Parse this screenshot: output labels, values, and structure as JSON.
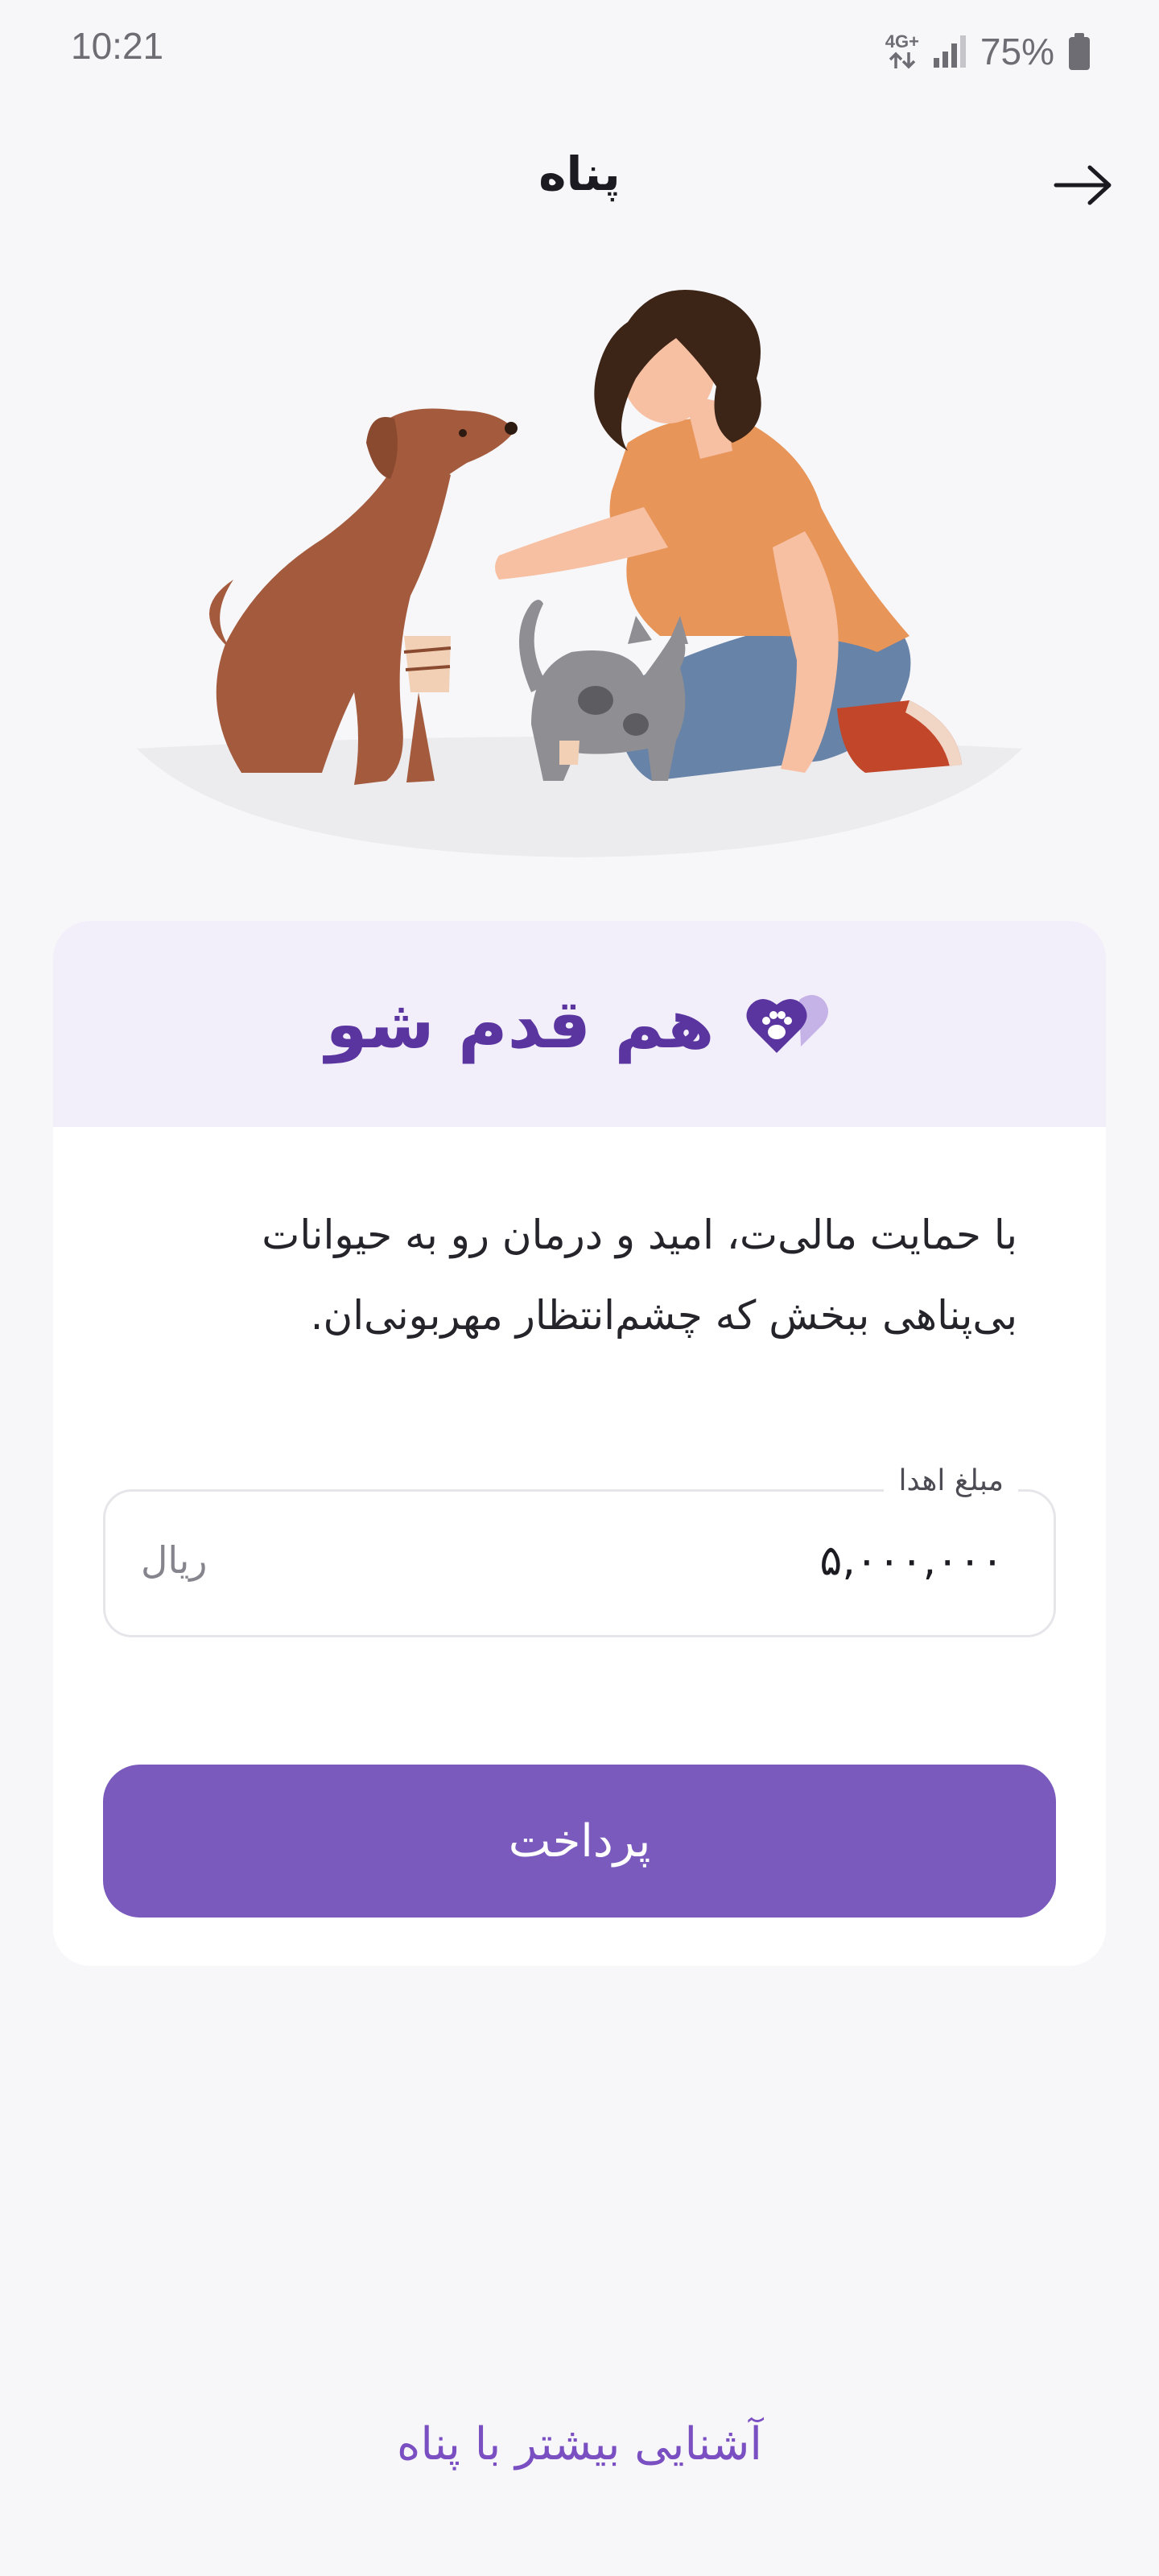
{
  "status_bar": {
    "time": "10:21",
    "network": "4G+",
    "battery_percent": "75%",
    "icons": [
      "data-arrows-icon",
      "signal-icon",
      "battery-icon"
    ]
  },
  "header": {
    "title": "پناه",
    "back_icon": "arrow-right-icon"
  },
  "hero": {
    "illustration": "woman-dog-cat-illustration"
  },
  "card": {
    "title": "هم قدم شو",
    "title_icon": "paw-heart-icon",
    "description": "با حمایت مالی‌ت، امید و درمان رو به حیوانات بی‌پناهی ببخش که چشم‌انتظار مهربونی‌ان.",
    "amount_field": {
      "label": "مبلغ اهدا",
      "value": "۵,۰۰۰,۰۰۰",
      "unit": "ریال"
    },
    "pay_button": "پرداخت"
  },
  "footer": {
    "link": "آشنایی بیشتر با پناه"
  },
  "colors": {
    "background": "#f7f7fa",
    "accent": "#7a5bbd",
    "title_purple": "#5a35a0",
    "header_tint": "#f3effa",
    "link_purple": "#7a4fc2"
  }
}
